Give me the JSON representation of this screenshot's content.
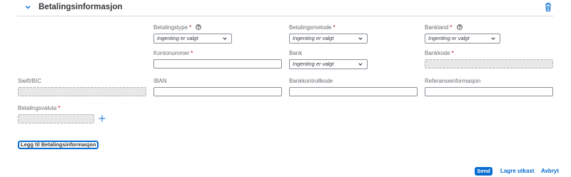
{
  "section": {
    "title": "Betalingsinformasjon"
  },
  "fields": {
    "betalingstype": {
      "label": "Betalingstype",
      "required": "*",
      "value": "Ingenting er valgt"
    },
    "betalingsmetode": {
      "label": "Betalingsmetode",
      "required": "*",
      "value": "Ingenting er valgt"
    },
    "bankland": {
      "label": "Bankland",
      "required": "*",
      "value": "Ingenting er valgt"
    },
    "kontonummer": {
      "label": "Kontonummer",
      "required": "*",
      "value": ""
    },
    "bank": {
      "label": "Bank",
      "value": "Ingenting er valgt"
    },
    "bankkode": {
      "label": "Bankkode",
      "required": "*",
      "value": ""
    },
    "swift": {
      "label": "Swift/BIC",
      "value": ""
    },
    "iban": {
      "label": "IBAN",
      "value": ""
    },
    "bankkontrollkode": {
      "label": "Bankkontrollkode",
      "value": ""
    },
    "referanse": {
      "label": "Referanseinformasjon",
      "value": ""
    },
    "betalingsvaluta": {
      "label": "Betalingsvaluta",
      "required": "*",
      "value": ""
    }
  },
  "actions": {
    "add_label": "Legg til Betalingsinformasjon",
    "send_label": "Send",
    "draft_label": "Lagre utkast",
    "cancel_label": "Avbryt"
  },
  "colors": {
    "accent": "#0a6ed1",
    "required": "#bb0000"
  },
  "icons": {
    "collapse": "chevron-down-icon",
    "delete": "trash-icon",
    "help": "help-icon",
    "add": "plus-icon"
  }
}
